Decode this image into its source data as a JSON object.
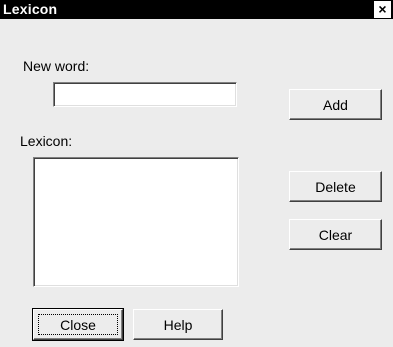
{
  "window": {
    "title": "Lexicon",
    "close_glyph": "×"
  },
  "new_word": {
    "label": "New word:",
    "value": "",
    "placeholder": ""
  },
  "lexicon": {
    "label": "Lexicon:",
    "items": []
  },
  "buttons": {
    "add": "Add",
    "delete": "Delete",
    "clear": "Clear",
    "close": "Close",
    "help": "Help"
  },
  "colors": {
    "titlebar": "#000000",
    "title_text": "#ffffff",
    "dialog_bg": "#ececec"
  }
}
